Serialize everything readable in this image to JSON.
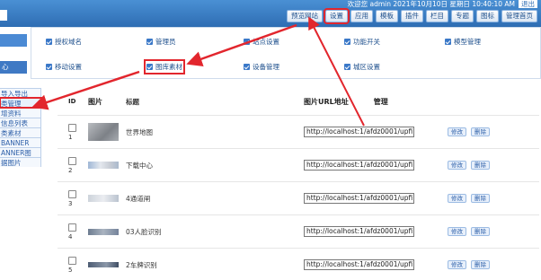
{
  "header": {
    "welcome": "欢迎您 admin  2021年10月10日 星期日 10:40:10 AM",
    "logout": "退出",
    "nav": [
      "预览网站",
      "设置",
      "应用",
      "模板",
      "插件",
      "栏目",
      "专题",
      "图标",
      "管理首页"
    ],
    "highlighted_nav": "设置"
  },
  "sidebar": {
    "tab1": "",
    "tab2": "心",
    "items": [
      "导入导出",
      "类管理",
      "增资料",
      "信息列表",
      "类素材",
      "BANNER",
      "ANNER图",
      "据图片"
    ],
    "highlighted_item": "类管理"
  },
  "settings_nav": {
    "row1": [
      "授权域名",
      "管理员",
      "站点设置",
      "功能开关",
      "模型管理"
    ],
    "row2": [
      "移动设置",
      "图库素材",
      "设备管理",
      "城区设置"
    ],
    "highlighted": "图库素材"
  },
  "table": {
    "headers": {
      "id": "ID",
      "image": "图片",
      "title": "标题",
      "url": "图片URL地址",
      "manage": "管理"
    },
    "rows": [
      {
        "id": "1",
        "title": "世界地图",
        "url": "http://localhost:1/afdz0001/upfi"
      },
      {
        "id": "2",
        "title": "下载中心",
        "url": "http://localhost:1/afdz0001/upfi"
      },
      {
        "id": "3",
        "title": "4通道闸",
        "url": "http://localhost:1/afdz0001/upfi"
      },
      {
        "id": "4",
        "title": "03人脸识别",
        "url": "http://localhost:1/afdz0001/upfi"
      },
      {
        "id": "5",
        "title": "2车牌识别",
        "url": "http://localhost:1/afdz0001/upfi"
      }
    ],
    "edit_label": "修改",
    "delete_label": "删除"
  },
  "colors": {
    "topbar": "#3a7fc8",
    "accent": "#2b5ea8",
    "highlight": "#e2262d"
  }
}
